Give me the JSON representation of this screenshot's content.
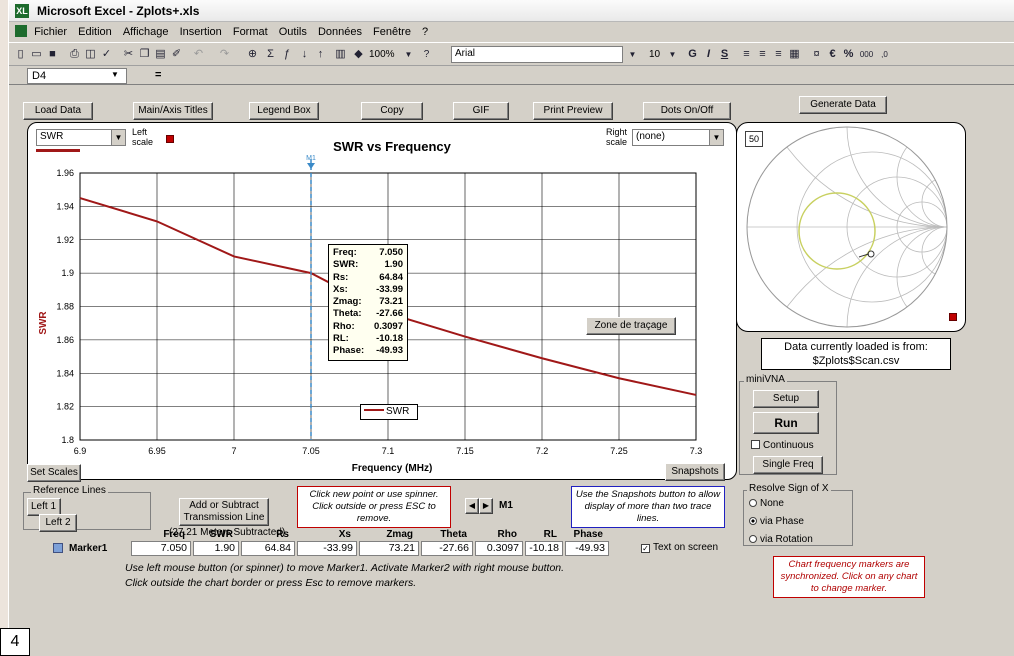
{
  "window": {
    "title": "Microsoft Excel - Zplots+.xls",
    "app_icon": "XL"
  },
  "menu": [
    "Fichier",
    "Edition",
    "Affichage",
    "Insertion",
    "Format",
    "Outils",
    "Données",
    "Fenêtre",
    "?"
  ],
  "toolbar": {
    "zoom": "100%",
    "font": "Arial",
    "font_size": "10",
    "bold": "G",
    "italic": "I",
    "underline": "S",
    "help": "?",
    "euro": "€",
    "percent": "%",
    "thousands": "000"
  },
  "formula": {
    "name_box": "D4",
    "eq": "="
  },
  "buttons": {
    "load_data": "Load Data",
    "main_axis_titles": "Main/Axis Titles",
    "legend_box": "Legend Box",
    "copy": "Copy",
    "gif": "GIF",
    "print_preview": "Print Preview",
    "dots_onoff": "Dots On/Off",
    "generate_data": "Generate Data",
    "set_scales": "Set Scales",
    "snapshots": "Snapshots",
    "left1": "Left 1",
    "left2": "Left 2",
    "add_subtract": "Add or Subtract Transmission Line",
    "setup": "Setup",
    "run": "Run",
    "single_freq": "Single Freq",
    "zone": "Zone de traçage"
  },
  "chart": {
    "left_select": "SWR",
    "left_scale_label": "Left scale",
    "right_scale_label": "Right scale",
    "right_select": "(none)",
    "marker_label": "M1",
    "legend": "SWR"
  },
  "chart_data": {
    "type": "line",
    "title": "SWR vs Frequency",
    "xlabel": "Frequency (MHz)",
    "ylabel": "SWR",
    "xlim": [
      6.9,
      7.3
    ],
    "ylim": [
      1.8,
      1.96
    ],
    "x_ticks": [
      "6.9",
      "6.95",
      "7",
      "7.05",
      "7.1",
      "7.15",
      "7.2",
      "7.25",
      "7.3"
    ],
    "y_ticks": [
      "1.96",
      "1.94",
      "1.92",
      "1.9",
      "1.88",
      "1.86",
      "1.84",
      "1.82",
      "1.8"
    ],
    "grid": true,
    "series": [
      {
        "name": "SWR",
        "color": "#a01818",
        "x": [
          6.9,
          6.95,
          7.0,
          7.05,
          7.1,
          7.15,
          7.2,
          7.25,
          7.3
        ],
        "y": [
          1.945,
          1.931,
          1.91,
          1.9,
          1.876,
          1.862,
          1.849,
          1.837,
          1.827
        ]
      }
    ],
    "marker": {
      "x": 7.05
    }
  },
  "tooltip": [
    {
      "k": "Freq:",
      "v": "7.050"
    },
    {
      "k": "SWR:",
      "v": "1.90"
    },
    {
      "k": "Rs:",
      "v": "64.84"
    },
    {
      "k": "Xs:",
      "v": "-33.99"
    },
    {
      "k": "Zmag:",
      "v": "73.21"
    },
    {
      "k": "Theta:",
      "v": "-27.66"
    },
    {
      "k": "Rho:",
      "v": "0.3097"
    },
    {
      "k": "RL:",
      "v": "-10.18"
    },
    {
      "k": "Phase:",
      "v": "-49.93"
    }
  ],
  "smith": {
    "ref": "50"
  },
  "data_source": {
    "line1": "Data currently loaded is from:",
    "line2": "$Zplots$Scan.csv"
  },
  "minivna": {
    "title": "miniVNA",
    "continuous": "Continuous"
  },
  "resolve": {
    "title": "Resolve Sign of X",
    "options": [
      "None",
      "via Phase",
      "via Rotation"
    ],
    "selected": 1
  },
  "reference_lines": {
    "title": "Reference Lines"
  },
  "subtracted": "(27.21 Meters Subtracted)",
  "notes": {
    "click_new": "Click new point or use spinner.  Click outside or press ESC to remove.",
    "snapshots": "Use the Snapshots button to allow display of more than two trace lines.",
    "sync": "Chart frequency markers are synchronized.  Click on any chart to change marker."
  },
  "spinner_label": "M1",
  "marker_table": {
    "name": "Marker1",
    "headers": [
      "Freq",
      "SWR",
      "Rs",
      "Xs",
      "Zmag",
      "Theta",
      "Rho",
      "RL",
      "Phase"
    ],
    "values": [
      "7.050",
      "1.90",
      "64.84",
      "-33.99",
      "73.21",
      "-27.66",
      "0.3097",
      "-10.18",
      "-49.93"
    ]
  },
  "text_on_screen": "Text on screen",
  "instructions": {
    "line1": "Use left mouse button (or spinner) to move Marker1.  Activate Marker2 with right mouse button.",
    "line2": "Click outside the chart border or press Esc to remove markers."
  },
  "figure_number": "4"
}
